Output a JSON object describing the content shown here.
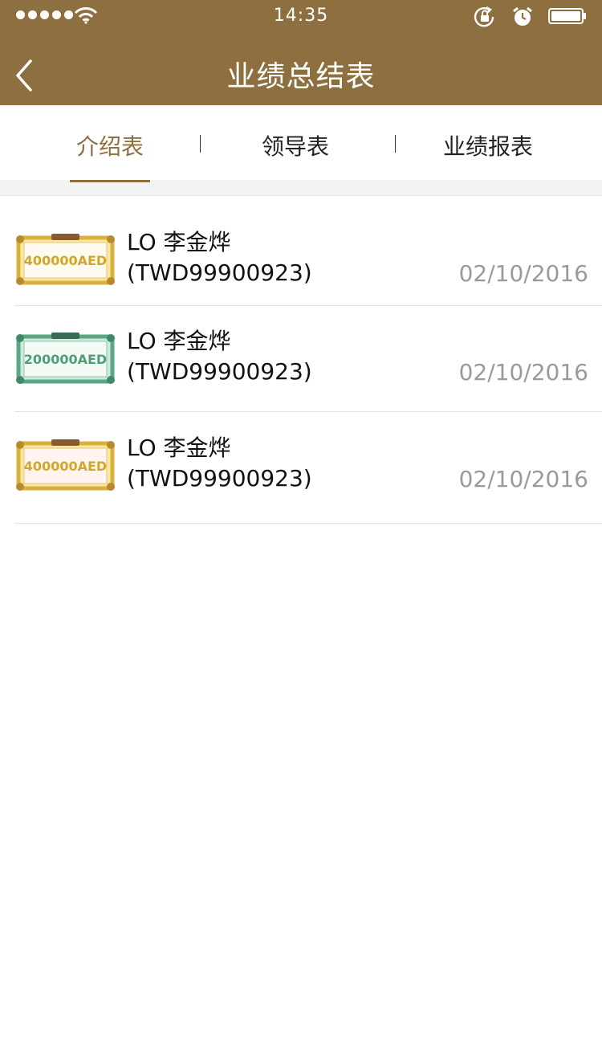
{
  "status_bar": {
    "time": "14:35",
    "icons": [
      "signal-dots-icon",
      "wifi-icon",
      "rotation-lock-icon",
      "alarm-icon",
      "battery-icon"
    ]
  },
  "header": {
    "title": "业绩总结表",
    "back_icon": "chevron-left-icon",
    "color": "#8e7040"
  },
  "tabs": [
    {
      "label": "介绍表",
      "active": true
    },
    {
      "label": "领导表",
      "active": false
    },
    {
      "label": "业绩报表",
      "active": false
    }
  ],
  "records": [
    {
      "certificate": "400000AED",
      "certificate_color": "gold",
      "name": "LO 李金烨",
      "code": "(TWD99900923)",
      "date": "02/10/2016"
    },
    {
      "certificate": "200000AED",
      "certificate_color": "green",
      "name": "LO 李金烨",
      "code": "(TWD99900923)",
      "date": "02/10/2016"
    },
    {
      "certificate": "400000AED",
      "certificate_color": "gold",
      "name": "LO 李金烨",
      "code": "(TWD99900923)",
      "date": "02/10/2016"
    }
  ],
  "colors": {
    "accent": "#8e7040",
    "gold_border": "#d9b23c",
    "gold_text": "#d1a72a",
    "green_border": "#5aa882",
    "green_text": "#4e9f78",
    "date_text": "#9a9a9a"
  }
}
